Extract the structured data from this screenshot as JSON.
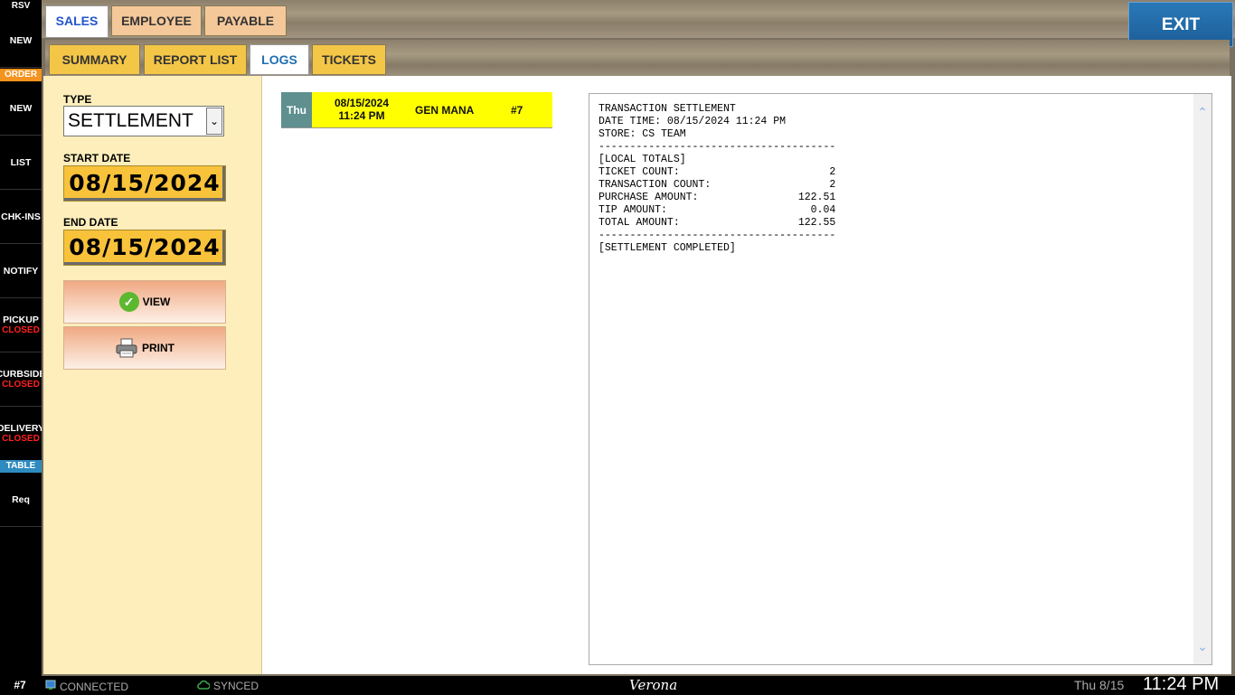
{
  "sidebar": {
    "header_rsv": "RSV",
    "rsv_new": "NEW",
    "header_order": "ORDER",
    "order_new": "NEW",
    "list": "LIST",
    "chk_ins": "CHK-INS",
    "notify": "NOTIFY",
    "pickup": "PICKUP",
    "pickup_status": "CLOSED",
    "curbside": "CURBSIDE",
    "curbside_status": "CLOSED",
    "delivery": "DELIVERY",
    "delivery_status": "CLOSED",
    "header_table": "TABLE",
    "req": "Req",
    "colors": {
      "order_header": "#f4931e",
      "table_header": "#2e8bbf",
      "closed": "#ff2020"
    }
  },
  "tabs": {
    "sales": "SALES",
    "employee": "EMPLOYEE",
    "payable": "PAYABLE"
  },
  "subtabs": {
    "summary": "SUMMARY",
    "report_list": "REPORT LIST",
    "logs": "LOGS",
    "tickets": "TICKETS"
  },
  "exit_label": "EXIT",
  "filters": {
    "type_label": "TYPE",
    "type_value": "SETTLEMENT",
    "start_label": "START DATE",
    "start_date": "08/15/2024",
    "end_label": "END DATE",
    "end_date": "08/15/2024",
    "view_label": "VIEW",
    "print_label": "PRINT"
  },
  "log": {
    "day": "Thu",
    "date": "08/15/2024",
    "time": "11:24 PM",
    "employee": "GEN MANA",
    "ticket": "#7"
  },
  "receipt": {
    "text": "TRANSACTION SETTLEMENT\nDATE TIME: 08/15/2024 11:24 PM\nSTORE: CS TEAM\n--------------------------------------\n[LOCAL TOTALS]\nTICKET COUNT:                        2\nTRANSACTION COUNT:                   2\nPURCHASE AMOUNT:                122.51\nTIP AMOUNT:                       0.04\nTOTAL AMOUNT:                   122.55\n--------------------------------------\n[SETTLEMENT COMPLETED]"
  },
  "status": {
    "ticket": "#7",
    "connected": "CONNECTED",
    "synced": "SYNCED",
    "brand": "Verona",
    "date": "Thu 8/15",
    "time": "11:24 PM"
  }
}
